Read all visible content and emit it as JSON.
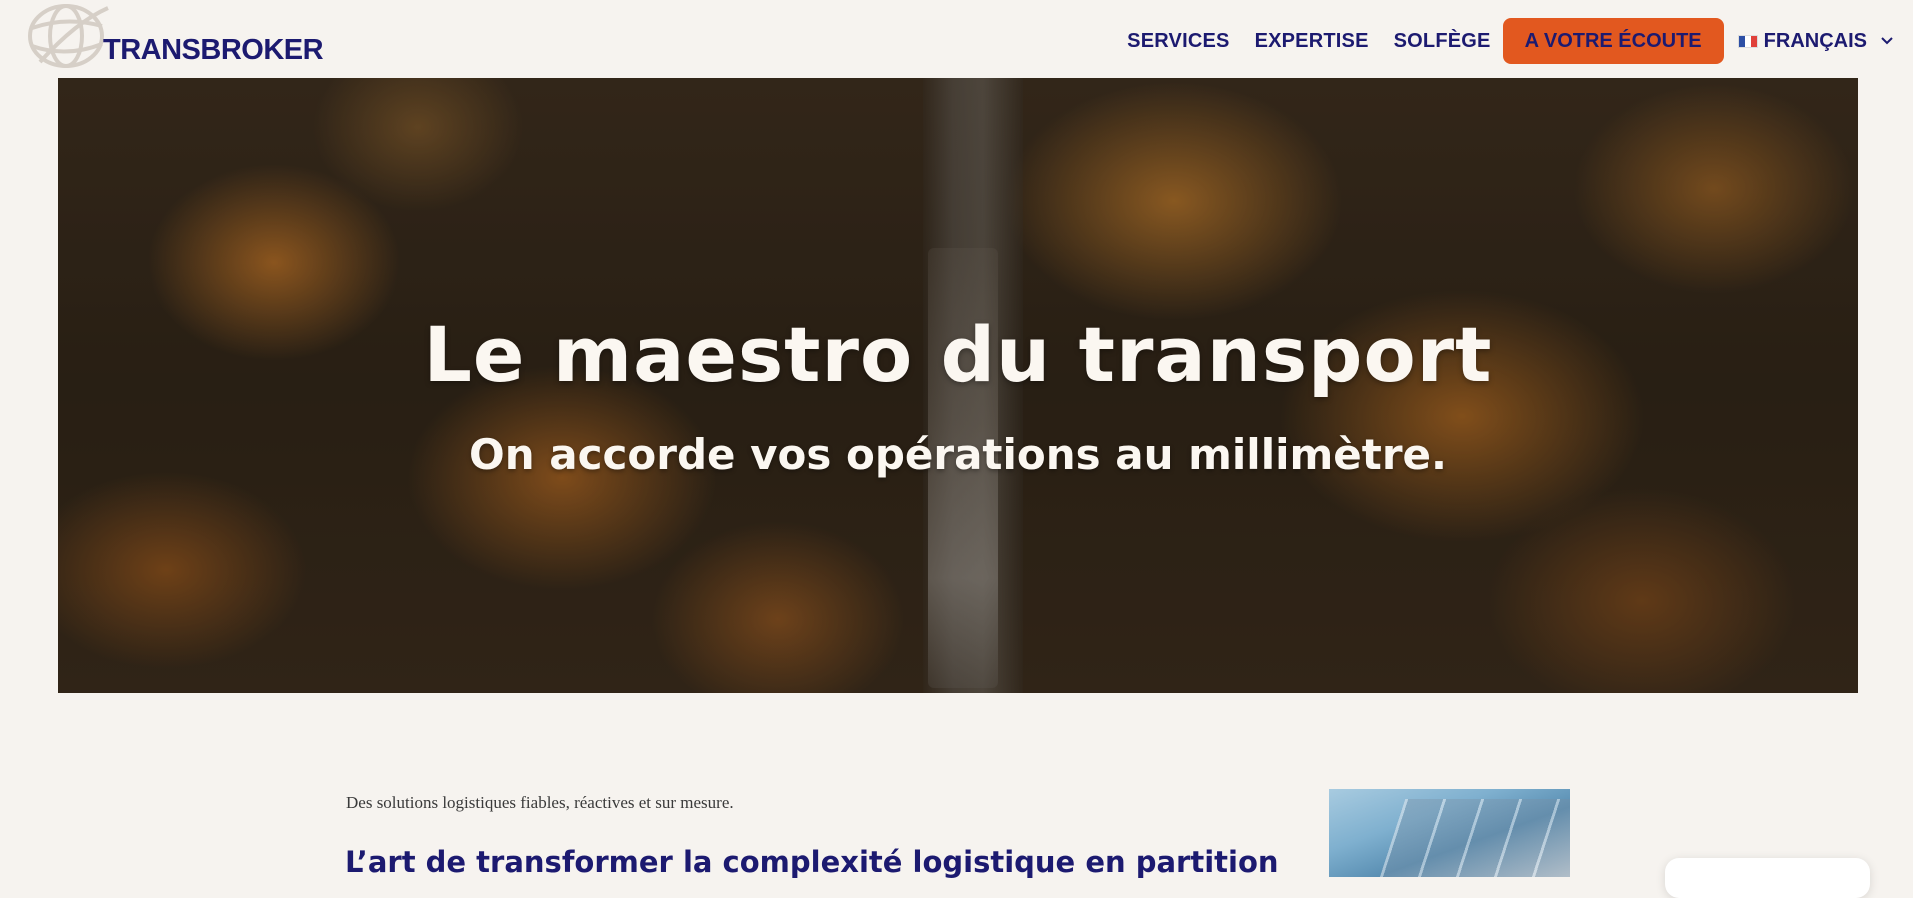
{
  "brand": {
    "name": "TRANSBROKER",
    "logo_icon": "globe-icon",
    "color": "#1c1a70",
    "accent": "#e2581f"
  },
  "nav": {
    "items": [
      {
        "label": "SERVICES"
      },
      {
        "label": "EXPERTISE"
      },
      {
        "label": "SOLFÈGE"
      }
    ],
    "cta_label": "A VOTRE ÉCOUTE",
    "language": {
      "label": "FRANÇAIS",
      "flag_icon": "france-flag-icon",
      "dropdown_icon": "chevron-down-icon"
    }
  },
  "hero": {
    "title": "Le maestro du transport",
    "subtitle": "On accorde vos opérations au millimètre."
  },
  "intro": {
    "tagline": "Des solutions logistiques fiables, réactives et sur mesure.",
    "heading": "L’art de transformer la complexité logistique en partition"
  }
}
